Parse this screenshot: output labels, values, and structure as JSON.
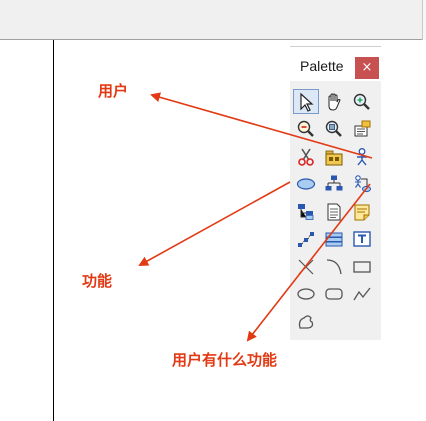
{
  "palette": {
    "title": "Palette",
    "close_glyph": "×",
    "tools": [
      {
        "icon": "arrow-pointer-icon",
        "selected": true
      },
      {
        "icon": "hand-pan-icon"
      },
      {
        "icon": "zoom-in-icon"
      },
      {
        "icon": "zoom-out-icon"
      },
      {
        "icon": "zoom-fit-icon"
      },
      {
        "icon": "properties-icon"
      },
      {
        "icon": "scissors-icon"
      },
      {
        "icon": "package-icon"
      },
      {
        "icon": "actor-icon"
      },
      {
        "icon": "use-case-icon"
      },
      {
        "icon": "hierarchy-icon"
      },
      {
        "icon": "actor-link-icon"
      },
      {
        "icon": "tree-icon"
      },
      {
        "icon": "document-icon"
      },
      {
        "icon": "note-icon"
      },
      {
        "icon": "steps-icon"
      },
      {
        "icon": "stack-icon"
      },
      {
        "icon": "text-box-icon"
      },
      {
        "icon": "line-icon"
      },
      {
        "icon": "arc-icon"
      },
      {
        "icon": "rectangle-icon"
      },
      {
        "icon": "ellipse-icon"
      },
      {
        "icon": "rounded-rectangle-icon"
      },
      {
        "icon": "polyline-icon"
      },
      {
        "icon": "freeform-icon"
      }
    ]
  },
  "annotations": {
    "user": "用户",
    "function": "功能",
    "user_functions": "用户有什么功能"
  },
  "colors": {
    "annotation": "#e23a14",
    "close_button": "#c75050",
    "palette_bg": "#f0f0f0"
  }
}
